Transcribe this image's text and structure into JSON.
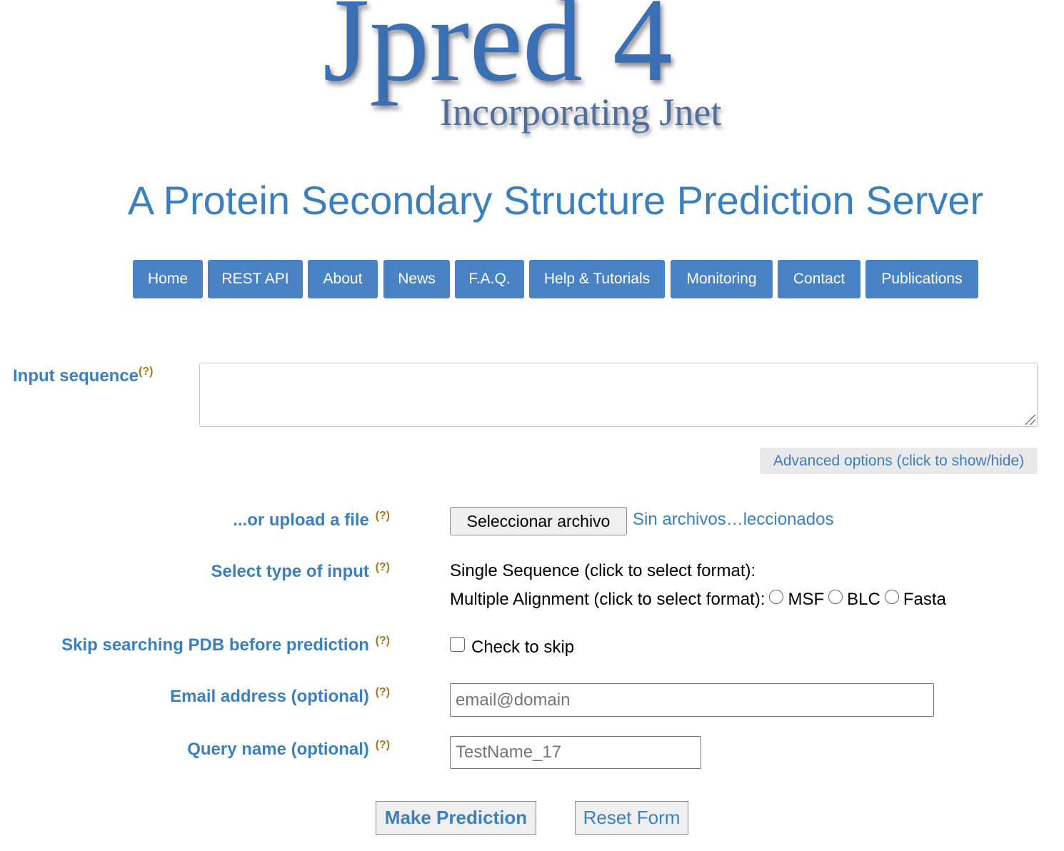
{
  "logo": {
    "title": "Jpred 4",
    "subtitle": "Incorporating Jnet"
  },
  "subtitle": "A Protein Secondary Structure Prediction Server",
  "nav": {
    "items": [
      {
        "label": "Home"
      },
      {
        "label": "REST API"
      },
      {
        "label": "About"
      },
      {
        "label": "News"
      },
      {
        "label": "F.A.Q."
      },
      {
        "label": "Help & Tutorials"
      },
      {
        "label": "Monitoring"
      },
      {
        "label": "Contact"
      },
      {
        "label": "Publications"
      }
    ]
  },
  "help_marker": "(?)",
  "form": {
    "input_sequence_label": "Input sequence",
    "input_sequence_value": "",
    "advanced_options_label": "Advanced options (click to show/hide)",
    "upload_label": "...or upload a file",
    "upload_button_label": "Seleccionar archivo",
    "upload_status": "Sin archivos…leccionados",
    "input_type_label": "Select type of input",
    "single_sequence_text": "Single Sequence (click to select format):",
    "multiple_alignment_text": "Multiple Alignment (click to select format):",
    "alignment_options": [
      "MSF",
      "BLC",
      "Fasta"
    ],
    "skip_pdb_label": "Skip searching PDB before prediction",
    "skip_pdb_checkbox_label": "Check to skip",
    "email_label": "Email address (optional)",
    "email_placeholder": "email@domain",
    "query_name_label": "Query name (optional)",
    "query_name_value": "TestName_17",
    "make_prediction_label": "Make Prediction",
    "reset_form_label": "Reset Form"
  },
  "colors": {
    "accent": "#3c7fbf",
    "nav_button": "#4a82c6",
    "help_marker": "#a3791f"
  }
}
